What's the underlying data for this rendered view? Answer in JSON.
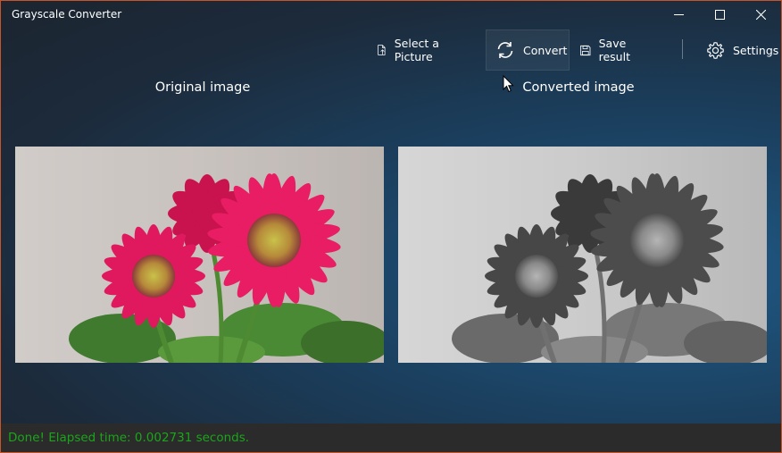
{
  "window": {
    "title": "Grayscale Converter",
    "controls": [
      "minimize-icon",
      "maximize-icon",
      "close-icon"
    ]
  },
  "toolbar": {
    "select_label": "Select a Picture",
    "convert_label": "Convert",
    "save_label": "Save result",
    "settings_label": "Settings",
    "icons": [
      "file-upload-icon",
      "refresh-icon",
      "save-icon",
      "gear-icon"
    ]
  },
  "main": {
    "original_caption": "Original image",
    "converted_caption": "Converted image"
  },
  "status": {
    "message": "Done! Elapsed time: 0.002731 seconds.",
    "color": "#1aa61a"
  },
  "colors": {
    "accent_border": "#c8552a",
    "flower_pink": "#e0195f",
    "status_bg": "#2b2b2b"
  }
}
